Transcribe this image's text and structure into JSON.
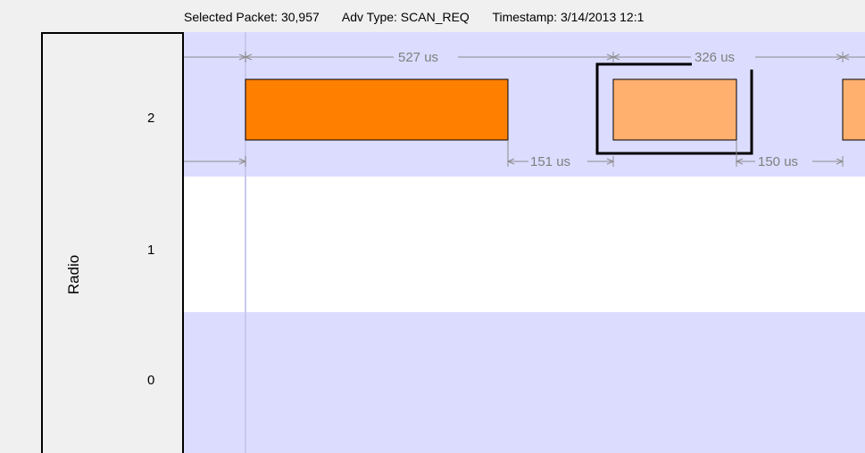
{
  "header": {
    "selected_packet": "Selected Packet: 30,957",
    "adv_type": "Adv Type: SCAN_REQ",
    "timestamp": "Timestamp: 3/14/2013 12:1"
  },
  "axis": {
    "title": "Radio",
    "ticks": [
      "2",
      "1",
      "0"
    ]
  },
  "colors": {
    "row_shade": "#dcdcff",
    "row_white": "#ffffff",
    "packet_primary": "#ff7f00",
    "packet_secondary": "#ffb06e",
    "dimension_line": "#8c8c8c",
    "selection_box": "#000000"
  },
  "timeline": {
    "durations": [
      {
        "label": "527 us"
      },
      {
        "label": "326 us"
      },
      {
        "label": "151 us"
      },
      {
        "label": "150 us"
      }
    ]
  }
}
